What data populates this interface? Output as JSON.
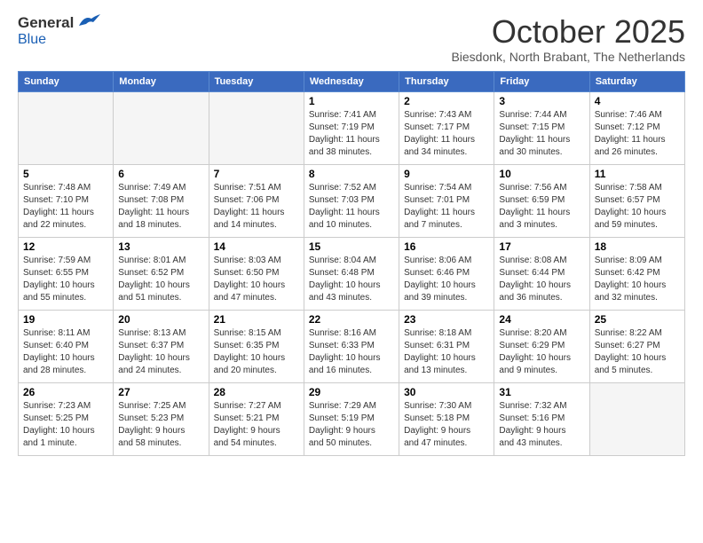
{
  "header": {
    "logo": {
      "general": "General",
      "blue": "Blue"
    },
    "title": "October 2025",
    "location": "Biesdonk, North Brabant, The Netherlands"
  },
  "days_of_week": [
    "Sunday",
    "Monday",
    "Tuesday",
    "Wednesday",
    "Thursday",
    "Friday",
    "Saturday"
  ],
  "weeks": [
    [
      {
        "day": "",
        "info": ""
      },
      {
        "day": "",
        "info": ""
      },
      {
        "day": "",
        "info": ""
      },
      {
        "day": "1",
        "info": "Sunrise: 7:41 AM\nSunset: 7:19 PM\nDaylight: 11 hours\nand 38 minutes."
      },
      {
        "day": "2",
        "info": "Sunrise: 7:43 AM\nSunset: 7:17 PM\nDaylight: 11 hours\nand 34 minutes."
      },
      {
        "day": "3",
        "info": "Sunrise: 7:44 AM\nSunset: 7:15 PM\nDaylight: 11 hours\nand 30 minutes."
      },
      {
        "day": "4",
        "info": "Sunrise: 7:46 AM\nSunset: 7:12 PM\nDaylight: 11 hours\nand 26 minutes."
      }
    ],
    [
      {
        "day": "5",
        "info": "Sunrise: 7:48 AM\nSunset: 7:10 PM\nDaylight: 11 hours\nand 22 minutes."
      },
      {
        "day": "6",
        "info": "Sunrise: 7:49 AM\nSunset: 7:08 PM\nDaylight: 11 hours\nand 18 minutes."
      },
      {
        "day": "7",
        "info": "Sunrise: 7:51 AM\nSunset: 7:06 PM\nDaylight: 11 hours\nand 14 minutes."
      },
      {
        "day": "8",
        "info": "Sunrise: 7:52 AM\nSunset: 7:03 PM\nDaylight: 11 hours\nand 10 minutes."
      },
      {
        "day": "9",
        "info": "Sunrise: 7:54 AM\nSunset: 7:01 PM\nDaylight: 11 hours\nand 7 minutes."
      },
      {
        "day": "10",
        "info": "Sunrise: 7:56 AM\nSunset: 6:59 PM\nDaylight: 11 hours\nand 3 minutes."
      },
      {
        "day": "11",
        "info": "Sunrise: 7:58 AM\nSunset: 6:57 PM\nDaylight: 10 hours\nand 59 minutes."
      }
    ],
    [
      {
        "day": "12",
        "info": "Sunrise: 7:59 AM\nSunset: 6:55 PM\nDaylight: 10 hours\nand 55 minutes."
      },
      {
        "day": "13",
        "info": "Sunrise: 8:01 AM\nSunset: 6:52 PM\nDaylight: 10 hours\nand 51 minutes."
      },
      {
        "day": "14",
        "info": "Sunrise: 8:03 AM\nSunset: 6:50 PM\nDaylight: 10 hours\nand 47 minutes."
      },
      {
        "day": "15",
        "info": "Sunrise: 8:04 AM\nSunset: 6:48 PM\nDaylight: 10 hours\nand 43 minutes."
      },
      {
        "day": "16",
        "info": "Sunrise: 8:06 AM\nSunset: 6:46 PM\nDaylight: 10 hours\nand 39 minutes."
      },
      {
        "day": "17",
        "info": "Sunrise: 8:08 AM\nSunset: 6:44 PM\nDaylight: 10 hours\nand 36 minutes."
      },
      {
        "day": "18",
        "info": "Sunrise: 8:09 AM\nSunset: 6:42 PM\nDaylight: 10 hours\nand 32 minutes."
      }
    ],
    [
      {
        "day": "19",
        "info": "Sunrise: 8:11 AM\nSunset: 6:40 PM\nDaylight: 10 hours\nand 28 minutes."
      },
      {
        "day": "20",
        "info": "Sunrise: 8:13 AM\nSunset: 6:37 PM\nDaylight: 10 hours\nand 24 minutes."
      },
      {
        "day": "21",
        "info": "Sunrise: 8:15 AM\nSunset: 6:35 PM\nDaylight: 10 hours\nand 20 minutes."
      },
      {
        "day": "22",
        "info": "Sunrise: 8:16 AM\nSunset: 6:33 PM\nDaylight: 10 hours\nand 16 minutes."
      },
      {
        "day": "23",
        "info": "Sunrise: 8:18 AM\nSunset: 6:31 PM\nDaylight: 10 hours\nand 13 minutes."
      },
      {
        "day": "24",
        "info": "Sunrise: 8:20 AM\nSunset: 6:29 PM\nDaylight: 10 hours\nand 9 minutes."
      },
      {
        "day": "25",
        "info": "Sunrise: 8:22 AM\nSunset: 6:27 PM\nDaylight: 10 hours\nand 5 minutes."
      }
    ],
    [
      {
        "day": "26",
        "info": "Sunrise: 7:23 AM\nSunset: 5:25 PM\nDaylight: 10 hours\nand 1 minute."
      },
      {
        "day": "27",
        "info": "Sunrise: 7:25 AM\nSunset: 5:23 PM\nDaylight: 9 hours\nand 58 minutes."
      },
      {
        "day": "28",
        "info": "Sunrise: 7:27 AM\nSunset: 5:21 PM\nDaylight: 9 hours\nand 54 minutes."
      },
      {
        "day": "29",
        "info": "Sunrise: 7:29 AM\nSunset: 5:19 PM\nDaylight: 9 hours\nand 50 minutes."
      },
      {
        "day": "30",
        "info": "Sunrise: 7:30 AM\nSunset: 5:18 PM\nDaylight: 9 hours\nand 47 minutes."
      },
      {
        "day": "31",
        "info": "Sunrise: 7:32 AM\nSunset: 5:16 PM\nDaylight: 9 hours\nand 43 minutes."
      },
      {
        "day": "",
        "info": ""
      }
    ]
  ]
}
